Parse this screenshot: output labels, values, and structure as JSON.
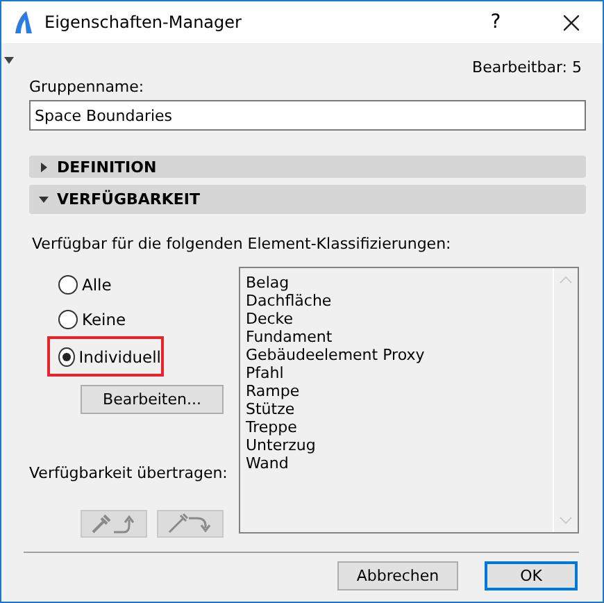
{
  "window": {
    "title": "Eigenschaften-Manager",
    "help": "?"
  },
  "editable_count": "Bearbeitbar: 5",
  "group_name": {
    "label": "Gruppenname:",
    "value": "Space Boundaries"
  },
  "sections": [
    {
      "label": "DEFINITION",
      "expanded": false
    },
    {
      "label": "VERFÜGBARKEIT",
      "expanded": true
    }
  ],
  "availability": {
    "prompt": "Verfügbar für die folgenden Element-Klassifizierungen:",
    "options": [
      {
        "label": "Alle",
        "selected": false,
        "highlighted": false
      },
      {
        "label": "Keine",
        "selected": false,
        "highlighted": false
      },
      {
        "label": "Individuell",
        "selected": true,
        "highlighted": true
      }
    ],
    "edit_button": "Bearbeiten...",
    "transfer_label": "Verfügbarkeit übertragen:",
    "classifications": [
      "Belag",
      "Dachfläche",
      "Decke",
      "Fundament",
      "Gebäudeelement Proxy",
      "Pfahl",
      "Rampe",
      "Stütze",
      "Treppe",
      "Unterzug",
      "Wand"
    ]
  },
  "buttons": [
    {
      "label": "Abbrechen",
      "default": false
    },
    {
      "label": "OK",
      "default": true
    }
  ]
}
